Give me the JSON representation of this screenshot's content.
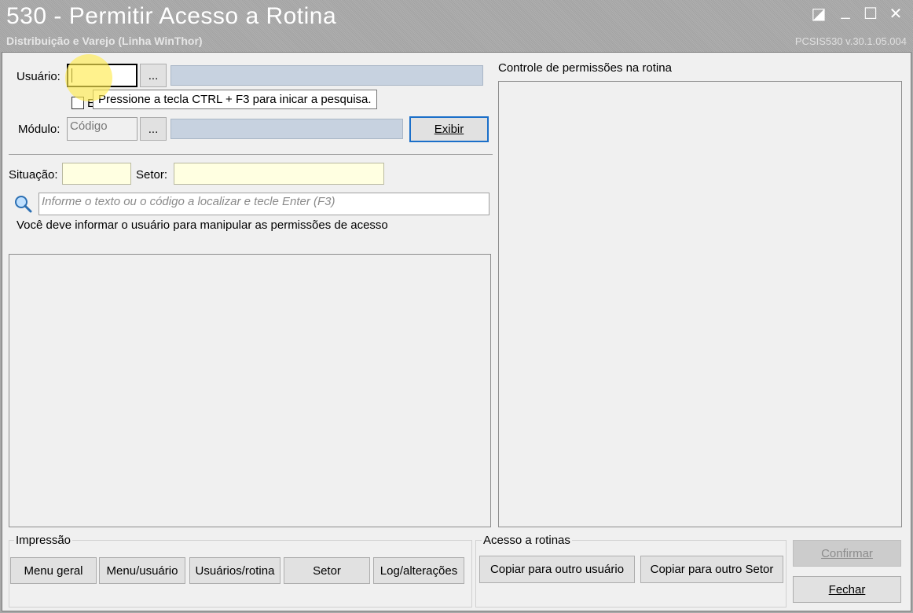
{
  "window": {
    "title": "530 - Permitir Acesso a Rotina",
    "subtitle": "Distribuição e Varejo (Linha WinThor)",
    "version": "PCSIS530  v.30.1.05.004",
    "controls": {
      "restore": "◪",
      "minimize": "_",
      "maximize": "☐",
      "close": "✕"
    }
  },
  "form": {
    "usuario_label": "Usuário:",
    "usuario_value": "",
    "browse_label": "...",
    "modulo_label": "Módulo:",
    "modulo_placeholder": "Código",
    "exibir_label": "Exibir",
    "checkbox_label": "E",
    "situacao_label": "Situação:",
    "setor_label": "Setor:",
    "search_placeholder": "Informe o texto ou o código a localizar e tecle Enter (F3)",
    "info_message": "Você deve informar o usuário para manipular as permissões de acesso"
  },
  "tooltip": {
    "text": "Pressione a tecla CTRL + F3 para inicar a pesquisa."
  },
  "right_panel": {
    "title": "Controle de permissões na rotina"
  },
  "impressao": {
    "title": "Impressão",
    "buttons": [
      "Menu geral",
      "Menu/usuário",
      "Usuários/rotina",
      "Setor",
      "Log/alterações"
    ]
  },
  "acesso": {
    "title": "Acesso a rotinas",
    "buttons": [
      "Copiar para outro usuário",
      "Copiar para outro Setor"
    ]
  },
  "actions": {
    "confirmar": "Confirmar",
    "fechar": "Fechar"
  },
  "colors": {
    "focus_blue": "#1b6fc9",
    "field_blue": "#c7d2e0",
    "field_yellow": "#ffffe1",
    "highlight": "#ffeb50"
  }
}
